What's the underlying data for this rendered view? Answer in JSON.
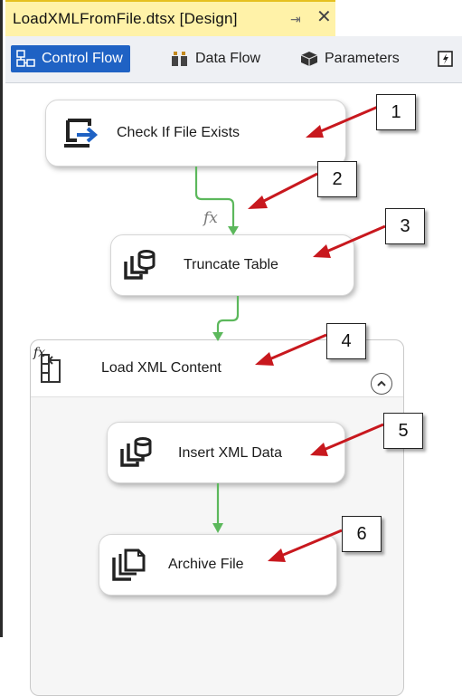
{
  "window": {
    "doc_tab_title": "LoadXMLFromFile.dtsx [Design]",
    "pin_glyph": "⇥",
    "close_glyph": "✕"
  },
  "designer_tabs": [
    {
      "label": "Control Flow",
      "icon": "control-flow-icon",
      "active": true
    },
    {
      "label": "Data Flow",
      "icon": "data-flow-icon",
      "active": false
    },
    {
      "label": "Parameters",
      "icon": "parameters-icon",
      "active": false
    }
  ],
  "tasks": {
    "check_file": {
      "label": "Check If File Exists",
      "icon": "script-task-icon"
    },
    "truncate": {
      "label": "Truncate Table",
      "icon": "sql-task-icon"
    },
    "insert_xml": {
      "label": "Insert XML Data",
      "icon": "sql-task-icon"
    },
    "archive": {
      "label": "Archive File",
      "icon": "file-system-task-icon"
    }
  },
  "container": {
    "label": "Load XML Content",
    "icon": "sequence-container-icon"
  },
  "expression_marker": "fx",
  "callouts": [
    "1",
    "2",
    "3",
    "4",
    "5",
    "6"
  ],
  "colors": {
    "tab_highlight": "#fff2a8",
    "active_tab": "#1f62c4",
    "precedence_arrow": "#5cb85c",
    "annotation_arrow": "#c8181e"
  }
}
